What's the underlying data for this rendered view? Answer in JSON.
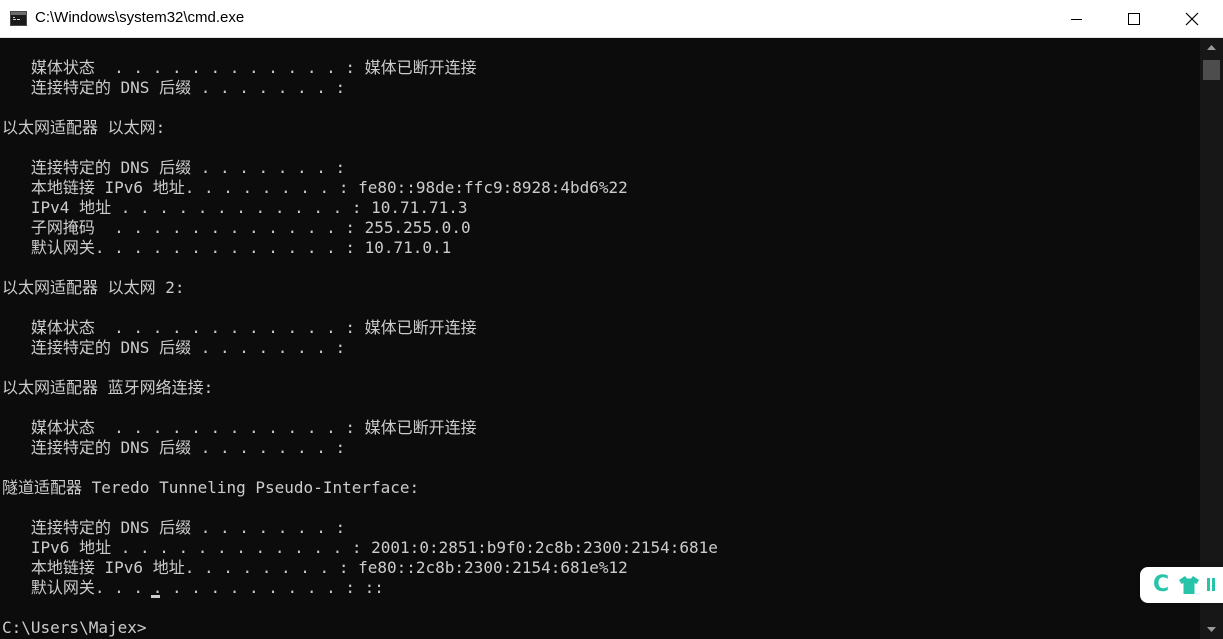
{
  "window": {
    "title": "C:\\Windows\\system32\\cmd.exe",
    "icon": "cmd-icon",
    "controls": [
      "minimize-icon",
      "maximize-icon",
      "close-icon"
    ]
  },
  "console": {
    "lines": [
      "   媒体状态  . . . . . . . . . . . . : 媒体已断开连接",
      "   连接特定的 DNS 后缀 . . . . . . . :",
      "",
      "以太网适配器 以太网:",
      "",
      "   连接特定的 DNS 后缀 . . . . . . . :",
      "   本地链接 IPv6 地址. . . . . . . . : fe80::98de:ffc9:8928:4bd6%22",
      "   IPv4 地址 . . . . . . . . . . . . : 10.71.71.3",
      "   子网掩码  . . . . . . . . . . . . : 255.255.0.0",
      "   默认网关. . . . . . . . . . . . . : 10.71.0.1",
      "",
      "以太网适配器 以太网 2:",
      "",
      "   媒体状态  . . . . . . . . . . . . : 媒体已断开连接",
      "   连接特定的 DNS 后缀 . . . . . . . :",
      "",
      "以太网适配器 蓝牙网络连接:",
      "",
      "   媒体状态  . . . . . . . . . . . . : 媒体已断开连接",
      "   连接特定的 DNS 后缀 . . . . . . . :",
      "",
      "隧道适配器 Teredo Tunneling Pseudo-Interface:",
      "",
      "   连接特定的 DNS 后缀 . . . . . . . :",
      "   IPv6 地址 . . . . . . . . . . . . : 2001:0:2851:b9f0:2c8b:2300:2154:681e",
      "   本地链接 IPv6 地址. . . . . . . . : fe80::2c8b:2300:2154:681e%12",
      "   默认网关. . . . . . . . . . . . . : ::",
      "",
      "C:\\Users\\Majex>"
    ]
  },
  "colors": {
    "console_background": "#0c0c0c",
    "console_text": "#cccccc",
    "titlebar_background": "#ffffff",
    "widget_accent": "#27c4a9"
  },
  "widget": {
    "letter": "C",
    "icons": [
      "shirt-icon",
      "more-icon"
    ]
  }
}
